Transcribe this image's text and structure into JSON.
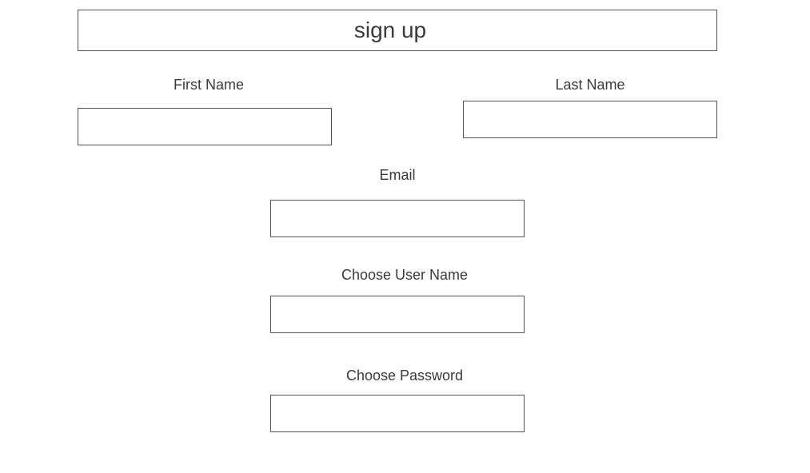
{
  "header": {
    "title": "sign up"
  },
  "form": {
    "first_name": {
      "label": "First Name",
      "value": "",
      "placeholder": ""
    },
    "last_name": {
      "label": "Last Name",
      "value": "",
      "placeholder": ""
    },
    "email": {
      "label": "Email",
      "value": "",
      "placeholder": ""
    },
    "username": {
      "label": "Choose User Name",
      "value": "",
      "placeholder": ""
    },
    "password": {
      "label": "Choose Password",
      "value": "",
      "placeholder": ""
    }
  },
  "colors": {
    "text": "#3a3a3a",
    "border": "#555555",
    "background": "#ffffff"
  }
}
